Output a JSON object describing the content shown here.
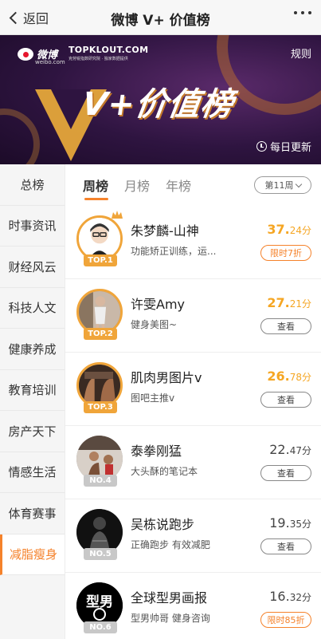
{
  "nav": {
    "back_label": "返回",
    "title": "微博 V+ 价值榜"
  },
  "banner": {
    "weibo_text": "微博",
    "weibo_sub": "weibo.com",
    "topklout": "TOPKLOUT.COM",
    "topklout_sub": "克劳锐指数研究院 · 独家数据提供",
    "rules_label": "规则",
    "main_title": "V+价值榜",
    "daily_update": "每日更新"
  },
  "sidebar": {
    "items": [
      {
        "label": "总榜"
      },
      {
        "label": "时事资讯"
      },
      {
        "label": "财经风云"
      },
      {
        "label": "科技人文"
      },
      {
        "label": "健康养成"
      },
      {
        "label": "教育培训"
      },
      {
        "label": "房产天下"
      },
      {
        "label": "情感生活"
      },
      {
        "label": "体育赛事"
      },
      {
        "label": "减脂瘦身"
      }
    ],
    "active_index": 9
  },
  "tabs": {
    "items": [
      {
        "label": "周榜"
      },
      {
        "label": "月榜"
      },
      {
        "label": "年榜"
      }
    ],
    "active_index": 0,
    "week_select": "第11周"
  },
  "list": [
    {
      "rank": "TOP.1",
      "name": "朱梦麟-山神",
      "desc": "功能矫正训练，运...",
      "score_int": "37.",
      "score_dec": "24",
      "unit": "分",
      "action": "限时7折",
      "action_type": "promo"
    },
    {
      "rank": "TOP.2",
      "name": "许雯Amy",
      "desc": "健身美图~",
      "score_int": "27.",
      "score_dec": "21",
      "unit": "分",
      "action": "查看",
      "action_type": "view"
    },
    {
      "rank": "TOP.3",
      "name": "肌肉男图片v",
      "desc": "图吧主推v",
      "score_int": "26.",
      "score_dec": "78",
      "unit": "分",
      "action": "查看",
      "action_type": "view"
    },
    {
      "rank": "NO.4",
      "name": "泰拳刚猛",
      "desc": "大头酥的笔记本",
      "score_int": "22.",
      "score_dec": "47",
      "unit": "分",
      "action": "查看",
      "action_type": "view"
    },
    {
      "rank": "NO.5",
      "name": "吴栋说跑步",
      "desc": "正确跑步 有效减肥",
      "score_int": "19.",
      "score_dec": "35",
      "unit": "分",
      "action": "查看",
      "action_type": "view"
    },
    {
      "rank": "NO.6",
      "name": "全球型男画报",
      "desc": "型男帅哥 健身咨询",
      "score_int": "16.",
      "score_dec": "32",
      "unit": "分",
      "action": "限时85折",
      "action_type": "promo"
    }
  ],
  "colors": {
    "accent": "#f5822b",
    "gold": "#f5a623",
    "banner_bg": "#2e1440"
  },
  "avatar_logo_text": "型男"
}
